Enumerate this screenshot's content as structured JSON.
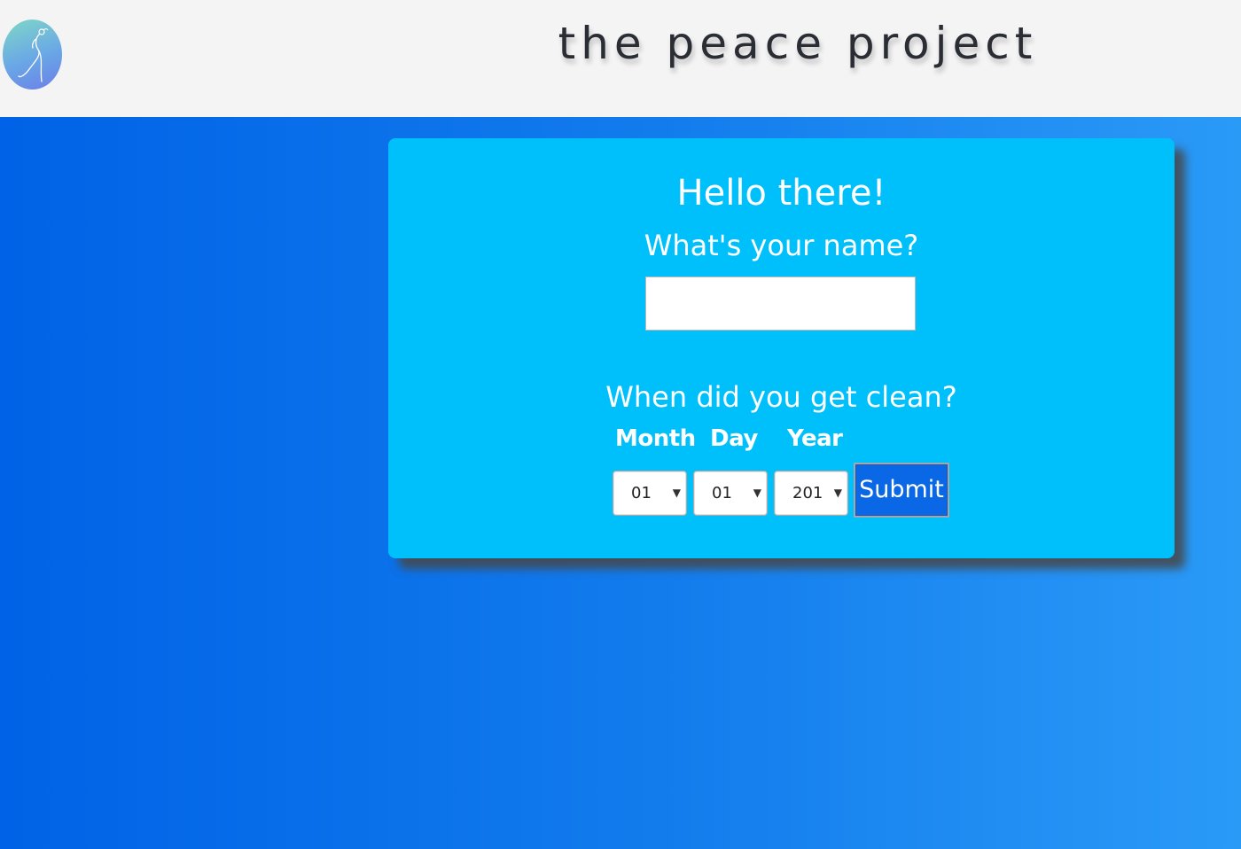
{
  "header": {
    "title": "the peace project",
    "logo_icon": "peace-figure-logo-icon"
  },
  "card": {
    "greeting": "Hello there!",
    "name_question": "What's your name?",
    "name_input": {
      "value": "",
      "placeholder": ""
    },
    "clean_question": "When did you get clean?",
    "date_labels": {
      "month": "Month",
      "day": "Day",
      "year": "Year"
    },
    "selects": {
      "month": "01",
      "day": "01",
      "year": "201"
    },
    "arrow_glyph": "▼",
    "submit_label": "Submit"
  },
  "colors": {
    "background_gradient_start": "#0062e6",
    "background_gradient_end": "#2a9af7",
    "header_bg": "#f4f4f5",
    "card_bg": "#00c0fc",
    "submit_bg": "#0a68e6",
    "text_white": "#ffffff"
  }
}
